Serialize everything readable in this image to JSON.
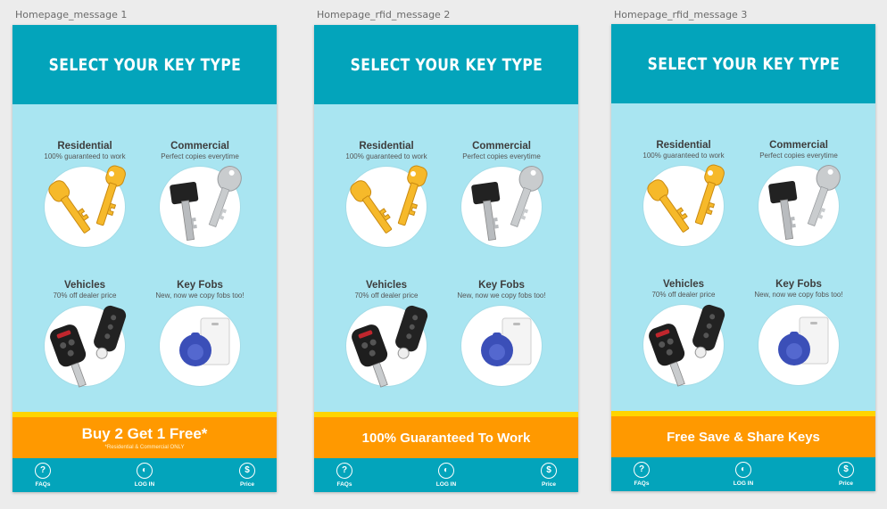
{
  "artboards": [
    {
      "label": "Homepage_message 1",
      "header_title": "SELECT YOUR KEY TYPE",
      "promo_text": "Buy 2 Get 1 Free*",
      "promo_note": "*Residential & Commercial ONLY"
    },
    {
      "label": "Homepage_rfid_message 2",
      "header_title": "SELECT YOUR KEY TYPE",
      "promo_text": "100% Guaranteed To Work",
      "promo_note": ""
    },
    {
      "label": "Homepage_rfid_message 3",
      "header_title": "SELECT YOUR KEY TYPE",
      "promo_text": "Free Save & Share Keys",
      "promo_note": ""
    }
  ],
  "categories": [
    {
      "name": "Residential",
      "subtitle": "100% guaranteed to work",
      "icon": "residential-keys-icon"
    },
    {
      "name": "Commercial",
      "subtitle": "Perfect copies everytime",
      "icon": "commercial-keys-icon"
    },
    {
      "name": "Vehicles",
      "subtitle": "70% off dealer price",
      "icon": "car-keys-icon"
    },
    {
      "name": "Key Fobs",
      "subtitle": "New, now we copy fobs too!",
      "icon": "key-fob-icon"
    }
  ],
  "tabs": [
    {
      "label": "FAQs",
      "icon": "help-icon",
      "glyph": "?"
    },
    {
      "label": "LOG IN",
      "icon": "login-icon",
      "glyph": "◐"
    },
    {
      "label": "Price",
      "icon": "price-icon",
      "glyph": "$"
    }
  ],
  "colors": {
    "header": "#03a4bb",
    "background": "#a9e5f1",
    "promo": "#ff9900",
    "promo_stripe": "#ffd400",
    "key_gold": "#f6b92a",
    "key_silver": "#c9ccce",
    "fob_blue": "#3b4fb8"
  }
}
